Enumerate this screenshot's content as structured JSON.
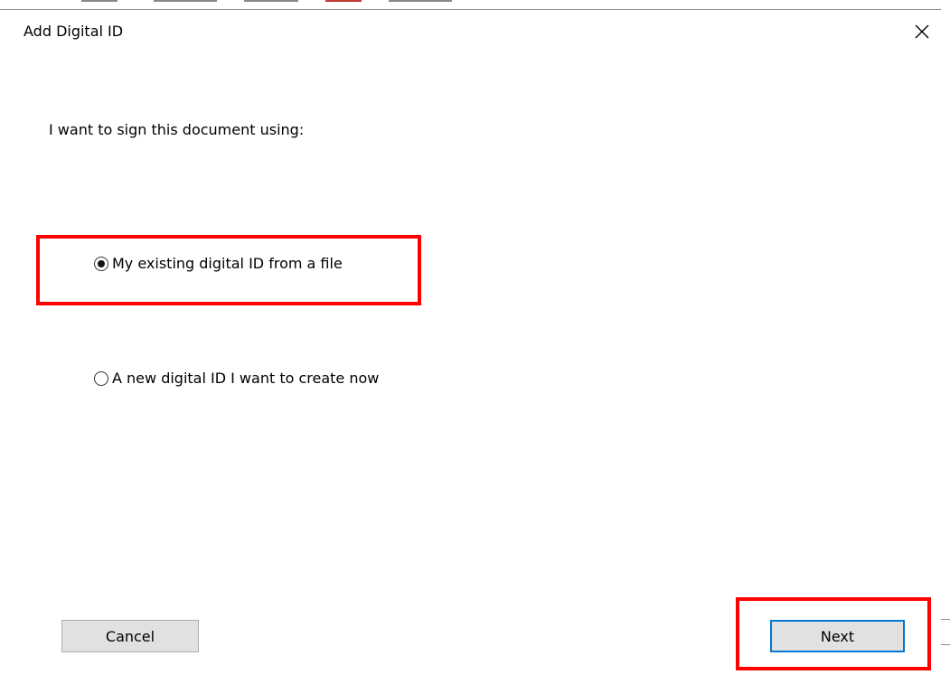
{
  "dialog": {
    "title": "Add Digital ID",
    "close_icon": "close-icon",
    "prompt": "I want to sign this document using:",
    "options": [
      {
        "label": "My existing digital ID from a file",
        "selected": true
      },
      {
        "label": "A new digital ID I want to create now",
        "selected": false
      }
    ],
    "buttons": {
      "cancel_label": "Cancel",
      "next_label": "Next"
    }
  },
  "colors": {
    "highlight": "#ff0000",
    "default_button_border": "#0078d7"
  }
}
